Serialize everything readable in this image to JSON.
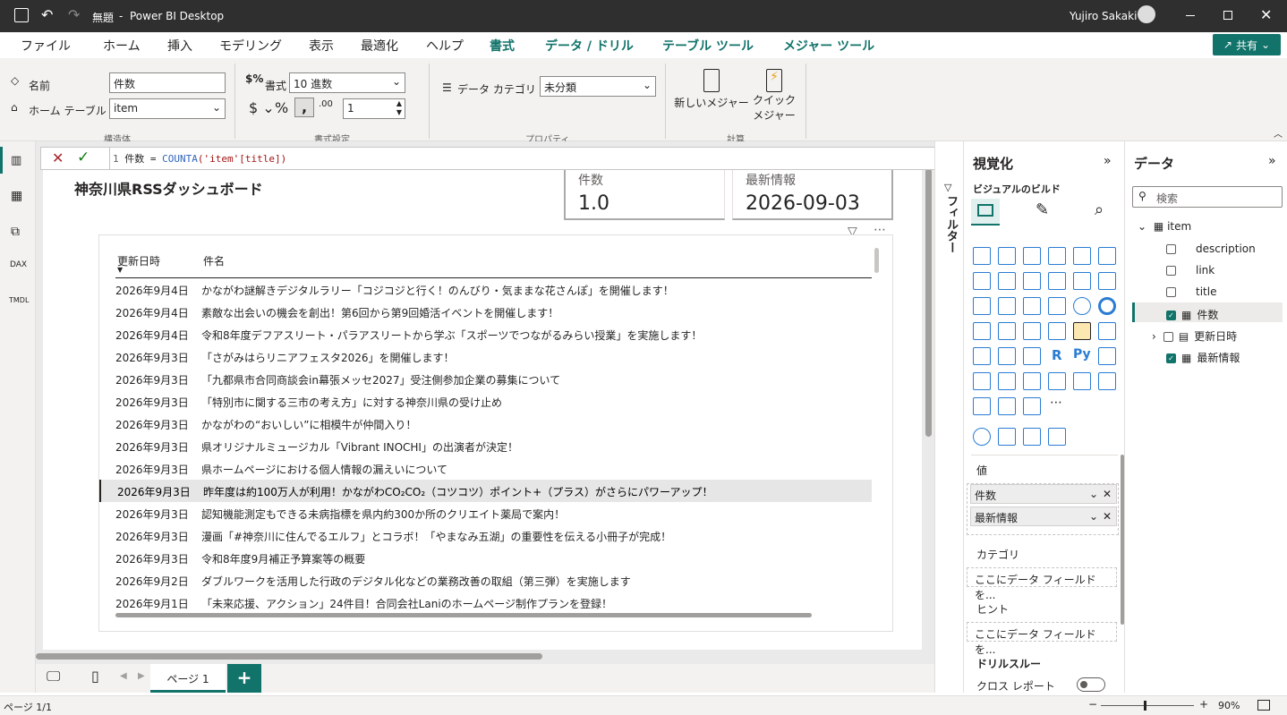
{
  "titlebar": {
    "doc": "無題",
    "app": "Power BI Desktop",
    "user": "Yujiro Sakaki"
  },
  "menu": {
    "items": [
      "ファイル",
      "ホーム",
      "挿入",
      "モデリング",
      "表示",
      "最適化",
      "ヘルプ"
    ],
    "ctx": [
      "書式",
      "データ / ドリル",
      "テーブル ツール",
      "メジャー ツール"
    ],
    "share": "共有"
  },
  "ribbon": {
    "name_label": "名前",
    "name_value": "件数",
    "home_table_label": "ホーム テーブル",
    "home_table_value": "item",
    "group_structure": "構造体",
    "format_label": "書式",
    "format_value": "10 進数",
    "decimals_value": "1",
    "group_format": "書式設定",
    "data_category_label": "データ カテゴリ",
    "data_category_value": "未分類",
    "group_properties": "プロパティ",
    "new_measure": "新しいメジャー",
    "quick_measure_1": "クイック",
    "quick_measure_2": "メジャー",
    "group_calc": "計算"
  },
  "formula": {
    "line": "1",
    "text_prefix": "件数 = ",
    "fn": "COUNTA",
    "args": "('item'[title])"
  },
  "report": {
    "title": "神奈川県RSSダッシュボード",
    "card1": {
      "label": "件数",
      "value": "1.0"
    },
    "card2": {
      "label": "最新情報",
      "value": "2026-09-03"
    },
    "table": {
      "headers": [
        "更新日時",
        "件名"
      ],
      "rows": [
        [
          "2026年9月4日",
          "かながわ謎解きデジタルラリー「コジコジと行く！のんびり・気ままな花さんぽ」を開催します！"
        ],
        [
          "2026年9月4日",
          "素敵な出会いの機会を創出！第6回から第9回婚活イベントを開催します！"
        ],
        [
          "2026年9月4日",
          "令和8年度デフアスリート・パラアスリートから学ぶ「スポーツでつながるみらい授業」を実施します！"
        ],
        [
          "2026年9月3日",
          "「さがみはらリニアフェスタ2026」を開催します！"
        ],
        [
          "2026年9月3日",
          "「九都県市合同商談会in幕張メッセ2027」受注側参加企業の募集について"
        ],
        [
          "2026年9月3日",
          "「特別市に関する三市の考え方」に対する神奈川県の受け止め"
        ],
        [
          "2026年9月3日",
          "かながわの“おいしい”に相模牛が仲間入り！"
        ],
        [
          "2026年9月3日",
          "県オリジナルミュージカル「Vibrant INOCHI」の出演者が決定！"
        ],
        [
          "2026年9月3日",
          "県ホームページにおける個人情報の漏えいについて"
        ],
        [
          "2026年9月3日",
          "昨年度は約100万人が利用！かながわCO₂CO₂（コツコツ）ポイント+（プラス）がさらにパワーアップ！"
        ],
        [
          "2026年9月3日",
          "認知機能測定もできる未病指標を県内約300か所のクリエイト薬局で案内！"
        ],
        [
          "2026年9月3日",
          "漫画「#神奈川に住んでるエルフ」とコラボ！「やまなみ五湖」の重要性を伝える小冊子が完成！"
        ],
        [
          "2026年9月3日",
          "令和8年度9月補正予算案等の概要"
        ],
        [
          "2026年9月2日",
          "ダブルワークを活用した行政のデジタル化などの業務改善の取組（第三弾）を実施します"
        ],
        [
          "2026年9月1日",
          "「未来応援、アクション」24件目！合同会社Laniのホームページ制作プランを登録！"
        ]
      ]
    }
  },
  "filters": {
    "label": "フィルター"
  },
  "viz": {
    "title": "視覚化",
    "build": "ビジュアルのビルド",
    "values_label": "値",
    "well_1": "件数",
    "well_2": "最新情報",
    "category_label": "カテゴリ",
    "category_ph": "ここにデータ フィールドを...",
    "hint_label": "ヒント",
    "hint_ph": "ここにデータ フィールドを...",
    "drill_label": "ドリルスルー",
    "cross_report": "クロス レポート"
  },
  "data": {
    "title": "データ",
    "search_ph": "検索",
    "table": "item",
    "fields": [
      {
        "name": "description",
        "checked": false
      },
      {
        "name": "link",
        "checked": false
      },
      {
        "name": "title",
        "checked": false
      },
      {
        "name": "件数",
        "checked": true
      },
      {
        "name": "更新日時",
        "checked": false
      },
      {
        "name": "最新情報",
        "checked": true
      }
    ]
  },
  "tabs": {
    "page1": "ページ 1"
  },
  "status": {
    "page": "ページ 1/1",
    "zoom": "90%"
  },
  "colors": {
    "accent": "#11736a",
    "titlebar": "#2f2f2f"
  }
}
